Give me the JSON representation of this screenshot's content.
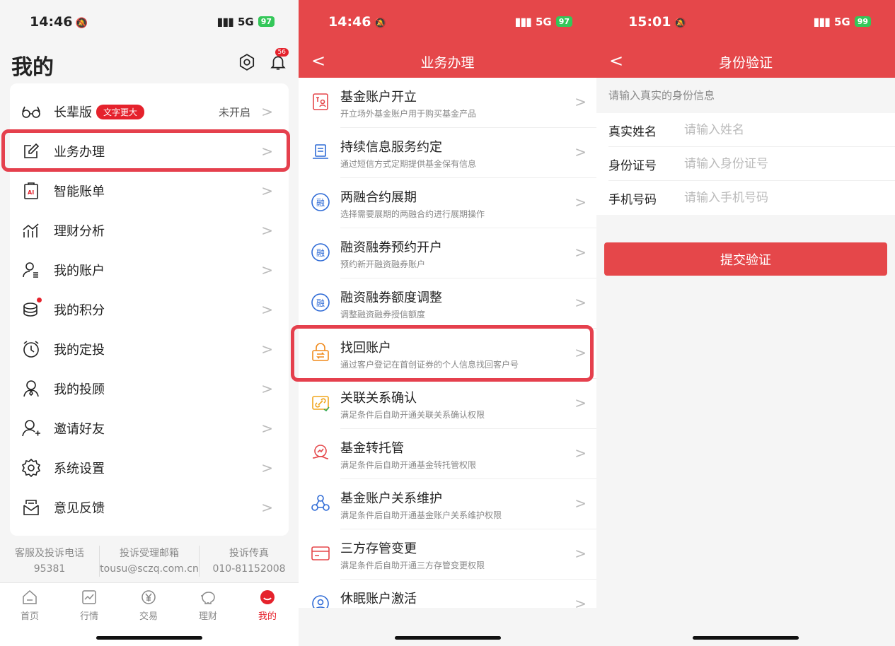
{
  "status": [
    {
      "time": "14:46",
      "signal": "5G",
      "battery": "97"
    },
    {
      "time": "14:46",
      "signal": "5G",
      "battery": "97"
    },
    {
      "time": "15:01",
      "signal": "5G",
      "battery": "99"
    }
  ],
  "profile": {
    "title": "我的",
    "notification_badge": "56",
    "menu": [
      {
        "label": "长辈版",
        "tag": "文字更大",
        "value": "未开启",
        "icon": "glasses-icon"
      },
      {
        "label": "业务办理",
        "icon": "edit-icon"
      },
      {
        "label": "智能账单",
        "icon": "ai-bill-icon"
      },
      {
        "label": "理财分析",
        "icon": "chart-icon"
      },
      {
        "label": "我的账户",
        "icon": "account-icon"
      },
      {
        "label": "我的积分",
        "icon": "coins-icon"
      },
      {
        "label": "我的定投",
        "icon": "alarm-icon"
      },
      {
        "label": "我的投顾",
        "icon": "advisor-icon"
      },
      {
        "label": "邀请好友",
        "icon": "add-friend-icon"
      },
      {
        "label": "系统设置",
        "icon": "gear-icon"
      },
      {
        "label": "意见反馈",
        "icon": "feedback-icon"
      }
    ],
    "contact": [
      {
        "label": "客服及投诉电话",
        "value": "95381"
      },
      {
        "label": "投诉受理邮箱",
        "value": "tousu@sczq.com.cn"
      },
      {
        "label": "投诉传真",
        "value": "010-81152008"
      }
    ],
    "tabs": [
      "首页",
      "行情",
      "交易",
      "理财",
      "我的"
    ]
  },
  "business": {
    "title": "业务办理",
    "items": [
      {
        "title": "基金账户开立",
        "desc": "开立场外基金账户用于购买基金产品",
        "icon": "fund-account-icon"
      },
      {
        "title": "持续信息服务约定",
        "desc": "通过短信方式定期提供基金保有信息",
        "icon": "info-service-icon"
      },
      {
        "title": "两融合约展期",
        "desc": "选择需要展期的两融合约进行展期操作",
        "icon": "margin-icon"
      },
      {
        "title": "融资融券预约开户",
        "desc": "预约新开融资融券账户",
        "icon": "margin-icon"
      },
      {
        "title": "融资融券额度调整",
        "desc": "调整融资融券授信额度",
        "icon": "margin-icon"
      },
      {
        "title": "找回账户",
        "desc": "通过客户登记在首创证券的个人信息找回客户号",
        "icon": "recover-account-icon"
      },
      {
        "title": "关联关系确认",
        "desc": "满足条件后自助开通关联关系确认权限",
        "icon": "link-icon"
      },
      {
        "title": "基金转托管",
        "desc": "满足条件后自助开通基金转托管权限",
        "icon": "transfer-icon"
      },
      {
        "title": "基金账户关系维护",
        "desc": "满足条件后自助开通基金账户关系维护权限",
        "icon": "relation-icon"
      },
      {
        "title": "三方存管变更",
        "desc": "满足条件后自助开通三方存管变更权限",
        "icon": "card-icon"
      },
      {
        "title": "休眠账户激活",
        "desc": "",
        "icon": "dormant-icon"
      }
    ]
  },
  "verify": {
    "title": "身份验证",
    "hint": "请输入真实的身份信息",
    "fields": [
      {
        "label": "真实姓名",
        "placeholder": "请输入姓名"
      },
      {
        "label": "身份证号",
        "placeholder": "请输入身份证号"
      },
      {
        "label": "手机号码",
        "placeholder": "请输入手机号码"
      }
    ],
    "submit": "提交验证"
  },
  "colors": {
    "primary": "#e5474a",
    "highlight": "#e5404d"
  }
}
